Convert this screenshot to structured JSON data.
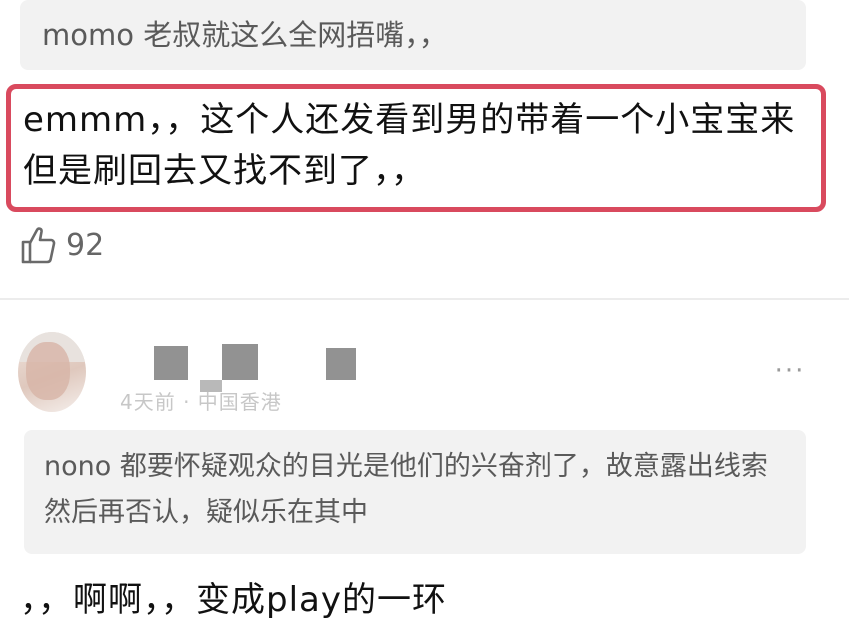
{
  "top_quote": {
    "text": "momo 老叔就这么全网捂嘴，，"
  },
  "highlighted_comment": {
    "text": "emmm，，这个人还发看到男的带着一个小宝宝来但是刷回去又找不到了，，",
    "highlight_color": "#d94a5e"
  },
  "likes": {
    "icon": "thumbs-up-icon",
    "count": "92"
  },
  "second_comment": {
    "meta": "4天前 · 中国香港",
    "more_label": "···",
    "quote_text": "nono 都要怀疑观众的目光是他们的兴奋剂了，故意露出线索然后再否认，疑似乐在其中",
    "reply_text": "，，啊啊，，变成play的一环"
  }
}
